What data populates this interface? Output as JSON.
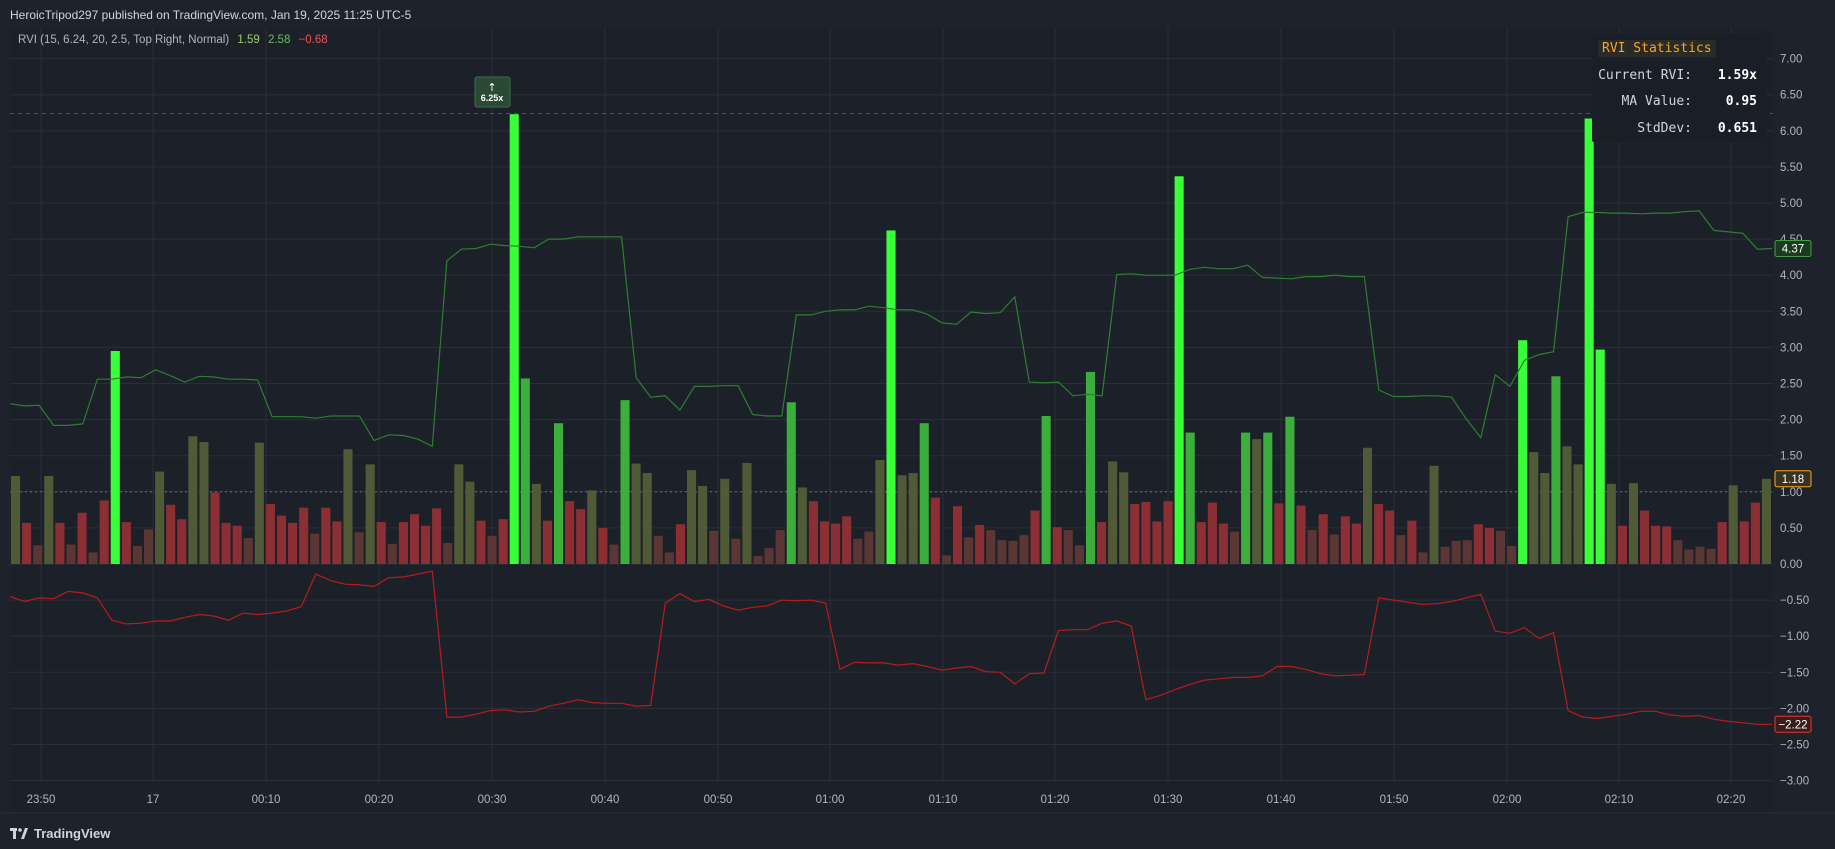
{
  "header": {
    "publisher": "HeroicTripod297 published on TradingView.com, Jan 19, 2025 11:25 UTC-5"
  },
  "footer": {
    "brand": "TradingView"
  },
  "legend": {
    "name": "RVI (15, 6.24, 20, 2.5, Top Right, Normal)",
    "v1": "1.59",
    "v2": "2.58",
    "v3": "−0.68"
  },
  "stats_panel": {
    "title": "RVI Statistics",
    "rows": [
      {
        "label": "Current RVI:",
        "value": "1.59x"
      },
      {
        "label": "MA Value:",
        "value": "0.95"
      },
      {
        "label": "StdDev:",
        "value": "0.651"
      }
    ]
  },
  "colors": {
    "background": "#1e222d",
    "grid": "#2a2e39",
    "spike": "#39ff39",
    "high": "#3cae3c",
    "mid": "#505a37",
    "low": "#8b2f35",
    "dim": "#5a3634",
    "upper_line": "#2e7d32",
    "lower_line": "#b71c1c"
  },
  "chart_data": {
    "type": "bar",
    "x_tick_labels": [
      "23:50",
      "17",
      "00:10",
      "00:20",
      "00:30",
      "00:40",
      "00:50",
      "01:00",
      "01:10",
      "01:20",
      "01:30",
      "01:40",
      "01:50",
      "02:00",
      "02:10",
      "02:20"
    ],
    "y_tick_labels": [
      "7.00",
      "6.50",
      "6.00",
      "5.50",
      "5.00",
      "4.50",
      "4.00",
      "3.50",
      "3.00",
      "2.50",
      "2.00",
      "1.50",
      "1.00",
      "0.50",
      "0.00",
      "-0.50",
      "-1.00",
      "-1.50",
      "-2.00",
      "-2.50",
      "-3.00"
    ],
    "ylim": [
      -3.0,
      7.0
    ],
    "threshold_line": 6.24,
    "baseline_line": 1.0,
    "annotation": {
      "arrow": "↑",
      "text": "6.25x"
    },
    "price_labels": {
      "upper": "4.37",
      "current": "1.18",
      "lower": "-2.22"
    },
    "bars": [
      1.22,
      0.57,
      0.26,
      1.22,
      0.57,
      0.27,
      0.71,
      0.16,
      0.88,
      2.95,
      0.58,
      0.25,
      0.48,
      1.28,
      0.82,
      0.62,
      1.77,
      1.69,
      0.99,
      0.57,
      0.53,
      0.36,
      1.68,
      0.83,
      0.67,
      0.57,
      0.78,
      0.42,
      0.78,
      0.59,
      1.59,
      0.44,
      1.38,
      0.58,
      0.28,
      0.58,
      0.69,
      0.53,
      0.77,
      0.29,
      1.38,
      1.14,
      0.6,
      0.39,
      0.62,
      6.23,
      2.57,
      1.11,
      0.6,
      1.95,
      0.87,
      0.76,
      1.02,
      0.5,
      0.27,
      2.27,
      1.39,
      1.26,
      0.39,
      0.16,
      0.55,
      1.3,
      1.08,
      0.46,
      1.18,
      0.35,
      1.4,
      0.11,
      0.22,
      0.47,
      2.24,
      1.06,
      0.87,
      0.59,
      0.56,
      0.66,
      0.35,
      0.45,
      1.44,
      4.62,
      1.23,
      1.26,
      1.95,
      0.92,
      0.12,
      0.8,
      0.37,
      0.54,
      0.47,
      0.33,
      0.32,
      0.4,
      0.74,
      2.05,
      0.51,
      0.47,
      0.26,
      2.66,
      0.58,
      1.42,
      1.27,
      0.83,
      0.86,
      0.59,
      0.87,
      5.37,
      1.82,
      0.58,
      0.85,
      0.56,
      0.45,
      1.82,
      1.73,
      1.82,
      0.84,
      2.04,
      0.81,
      0.47,
      0.69,
      0.41,
      0.66,
      0.56,
      1.61,
      0.83,
      0.74,
      0.4,
      0.6,
      0.16,
      1.36,
      0.24,
      0.32,
      0.33,
      0.55,
      0.5,
      0.46,
      0.25,
      3.1,
      1.55,
      1.26,
      2.6,
      1.63,
      1.38,
      6.17,
      2.97,
      1.11,
      0.53,
      1.12,
      0.74,
      0.53,
      0.52,
      0.33,
      0.2,
      0.24,
      0.21,
      0.58,
      1.09,
      0.59,
      0.85,
      1.18
    ],
    "upper_band": [
      2.22,
      2.19,
      2.2,
      1.92,
      1.92,
      1.94,
      2.56,
      2.56,
      2.59,
      2.58,
      2.69,
      2.61,
      2.52,
      2.6,
      2.59,
      2.56,
      2.56,
      2.55,
      2.04,
      2.04,
      2.04,
      2.02,
      2.05,
      2.05,
      2.05,
      1.71,
      1.79,
      1.78,
      1.73,
      1.63,
      4.2,
      4.36,
      4.37,
      4.43,
      4.41,
      4.4,
      4.38,
      4.5,
      4.5,
      4.53,
      4.53,
      4.53,
      4.53,
      2.58,
      2.31,
      2.33,
      2.13,
      2.46,
      2.46,
      2.47,
      2.47,
      2.07,
      2.05,
      2.05,
      3.45,
      3.45,
      3.5,
      3.52,
      3.52,
      3.57,
      3.55,
      3.52,
      3.52,
      3.46,
      3.34,
      3.32,
      3.49,
      3.47,
      3.48,
      3.7,
      2.52,
      2.51,
      2.52,
      2.33,
      2.35,
      2.33,
      4.01,
      4.02,
      4.0,
      4.0,
      4.0,
      4.08,
      4.11,
      4.09,
      4.09,
      4.14,
      3.97,
      3.96,
      3.95,
      3.98,
      3.98,
      4.0,
      3.98,
      3.98,
      2.41,
      2.32,
      2.32,
      2.33,
      2.33,
      2.31,
      2.01,
      1.75,
      2.62,
      2.46,
      2.82,
      2.9,
      2.94,
      4.81,
      4.87,
      4.87,
      4.86,
      4.86,
      4.85,
      4.86,
      4.86,
      4.88,
      4.89,
      4.62,
      4.6,
      4.58,
      4.36,
      4.37
    ],
    "lower_band": [
      -0.45,
      -0.52,
      -0.47,
      -0.48,
      -0.38,
      -0.4,
      -0.47,
      -0.78,
      -0.83,
      -0.82,
      -0.79,
      -0.79,
      -0.74,
      -0.7,
      -0.72,
      -0.78,
      -0.68,
      -0.7,
      -0.68,
      -0.65,
      -0.59,
      -0.14,
      -0.23,
      -0.28,
      -0.29,
      -0.31,
      -0.19,
      -0.18,
      -0.14,
      -0.1,
      -2.12,
      -2.12,
      -2.08,
      -2.03,
      -2.02,
      -2.05,
      -2.04,
      -1.97,
      -1.93,
      -1.88,
      -1.92,
      -1.93,
      -1.93,
      -1.97,
      -1.96,
      -0.54,
      -0.41,
      -0.52,
      -0.49,
      -0.58,
      -0.64,
      -0.6,
      -0.58,
      -0.5,
      -0.51,
      -0.5,
      -0.54,
      -1.46,
      -1.36,
      -1.37,
      -1.37,
      -1.4,
      -1.38,
      -1.42,
      -1.47,
      -1.44,
      -1.42,
      -1.49,
      -1.5,
      -1.66,
      -1.52,
      -1.51,
      -0.92,
      -0.91,
      -0.91,
      -0.82,
      -0.79,
      -0.86,
      -1.88,
      -1.82,
      -1.74,
      -1.67,
      -1.61,
      -1.59,
      -1.57,
      -1.57,
      -1.55,
      -1.42,
      -1.42,
      -1.46,
      -1.52,
      -1.55,
      -1.54,
      -1.53,
      -0.47,
      -0.5,
      -0.53,
      -0.56,
      -0.55,
      -0.52,
      -0.47,
      -0.42,
      -0.93,
      -0.96,
      -0.88,
      -1.03,
      -0.95,
      -2.03,
      -2.12,
      -2.14,
      -2.11,
      -2.08,
      -2.04,
      -2.04,
      -2.09,
      -2.11,
      -2.1,
      -2.15,
      -2.18,
      -2.2,
      -2.22,
      -2.22
    ]
  }
}
